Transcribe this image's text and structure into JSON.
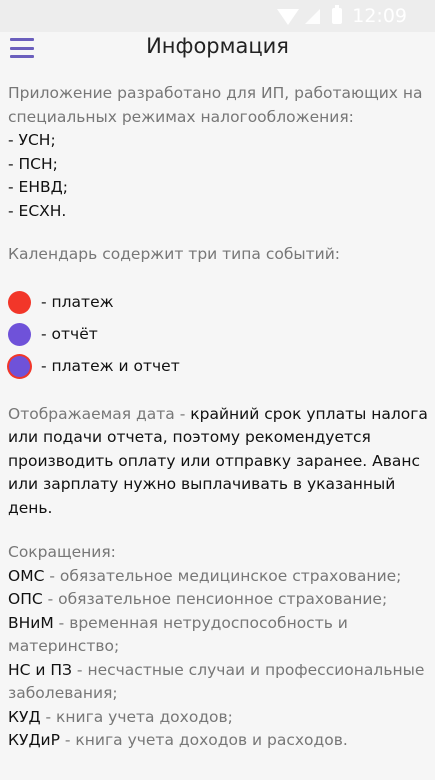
{
  "status_bar": {
    "time": "12:09"
  },
  "header": {
    "title": "Информация"
  },
  "intro": {
    "text": "Приложение разработано для ИП, работающих на специальных режимах налогообложения:",
    "regimes": [
      "- УСН;",
      "- ПСН;",
      "- ЕНВД;",
      "- ЕСХН."
    ]
  },
  "calendar": {
    "intro": "Календарь содержит три типа событий:",
    "events": [
      {
        "label": "- платеж",
        "color": "#f23629"
      },
      {
        "label": "- отчёт",
        "color": "#6f52d9"
      },
      {
        "label": "- платеж и отчет",
        "color": "#6f52d9"
      }
    ]
  },
  "date_note": {
    "prefix": "Отображаемая дата - ",
    "text": "крайний срок уплаты налога или подачи отчета, поэтому рекомендуется производить оплату или отправку заранее. Аванс или зарплату нужно выплачивать в указанный день."
  },
  "abbreviations": {
    "heading": "Сокращения:",
    "items": [
      {
        "term": "ОМС",
        "desc": " - обязательное медицинское страхование;"
      },
      {
        "term": "ОПС",
        "desc": " - обязательное пенсионное страхование;"
      },
      {
        "term": "ВНиМ",
        "desc": " - временная нетрудоспособность и материнство;"
      },
      {
        "term": "НС и ПЗ",
        "desc": " - несчастные случаи и профессиональные заболевания;"
      },
      {
        "term": "КУД",
        "desc": " - книга учета доходов;"
      },
      {
        "term": "КУДиР",
        "desc": " - книга учета доходов и расходов."
      }
    ]
  },
  "colors": {
    "accent": "#6b5fbd",
    "payment": "#f23629",
    "report": "#6f52d9"
  }
}
